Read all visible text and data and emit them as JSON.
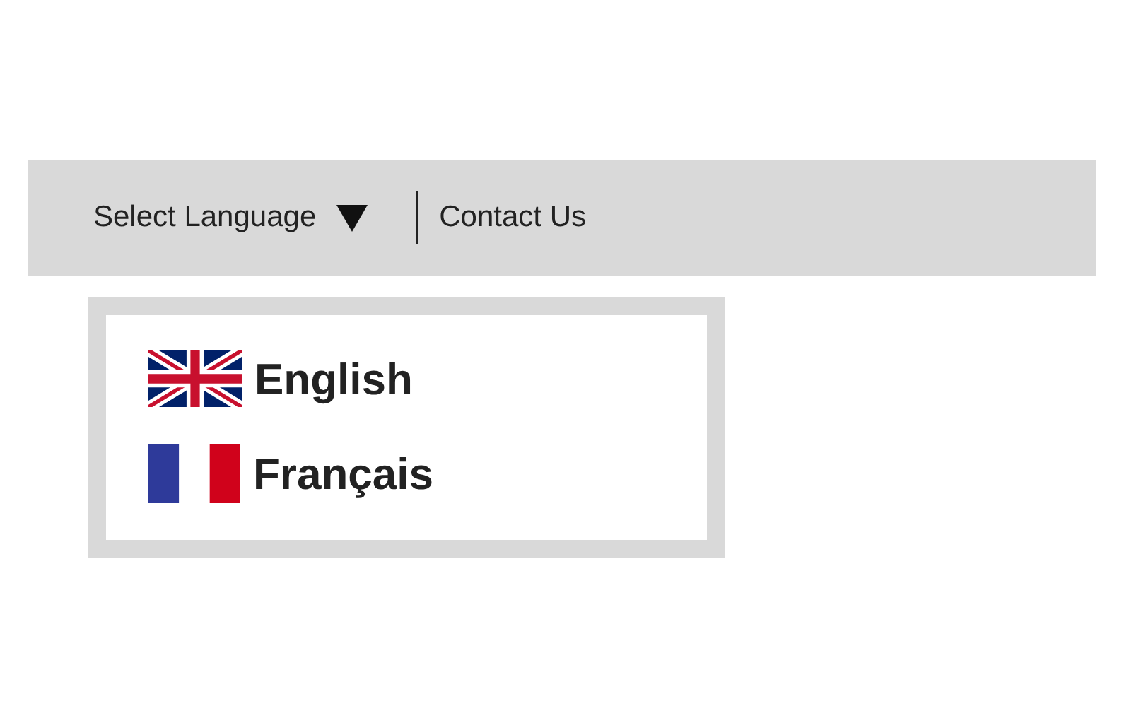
{
  "nav": {
    "language_menu": {
      "label": "Select Language",
      "expanded": true,
      "options": [
        {
          "label": "English",
          "kind": "uk"
        },
        {
          "label": "Français",
          "kind": "france"
        }
      ]
    },
    "links": [
      "Contact Us"
    ]
  }
}
